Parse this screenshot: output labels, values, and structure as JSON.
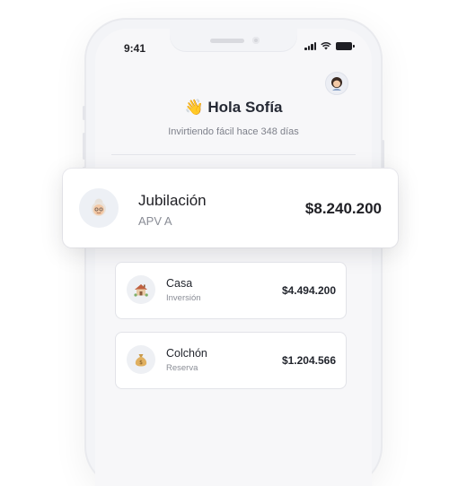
{
  "status": {
    "time": "9:41"
  },
  "header": {
    "greeting_emoji": "👋",
    "greeting": "Hola Sofía",
    "subtitle": "Invirtiendo fácil hace 348 días",
    "avatar_icon": "woman-avatar-icon"
  },
  "featured_goal": {
    "title": "Jubilación",
    "subtitle": "APV A",
    "amount": "$8.240.200",
    "icon": "elderly-woman-icon"
  },
  "goals": [
    {
      "title": "Casa",
      "subtitle": "Inversión",
      "amount": "$4.494.200",
      "icon": "house-icon"
    },
    {
      "title": "Colchón",
      "subtitle": "Reserva",
      "amount": "$1.204.566",
      "icon": "money-bag-icon"
    }
  ],
  "colors": {
    "background": "#f7f7f9",
    "card": "#ffffff",
    "text": "#1f1f24",
    "muted": "#8a8d96"
  }
}
